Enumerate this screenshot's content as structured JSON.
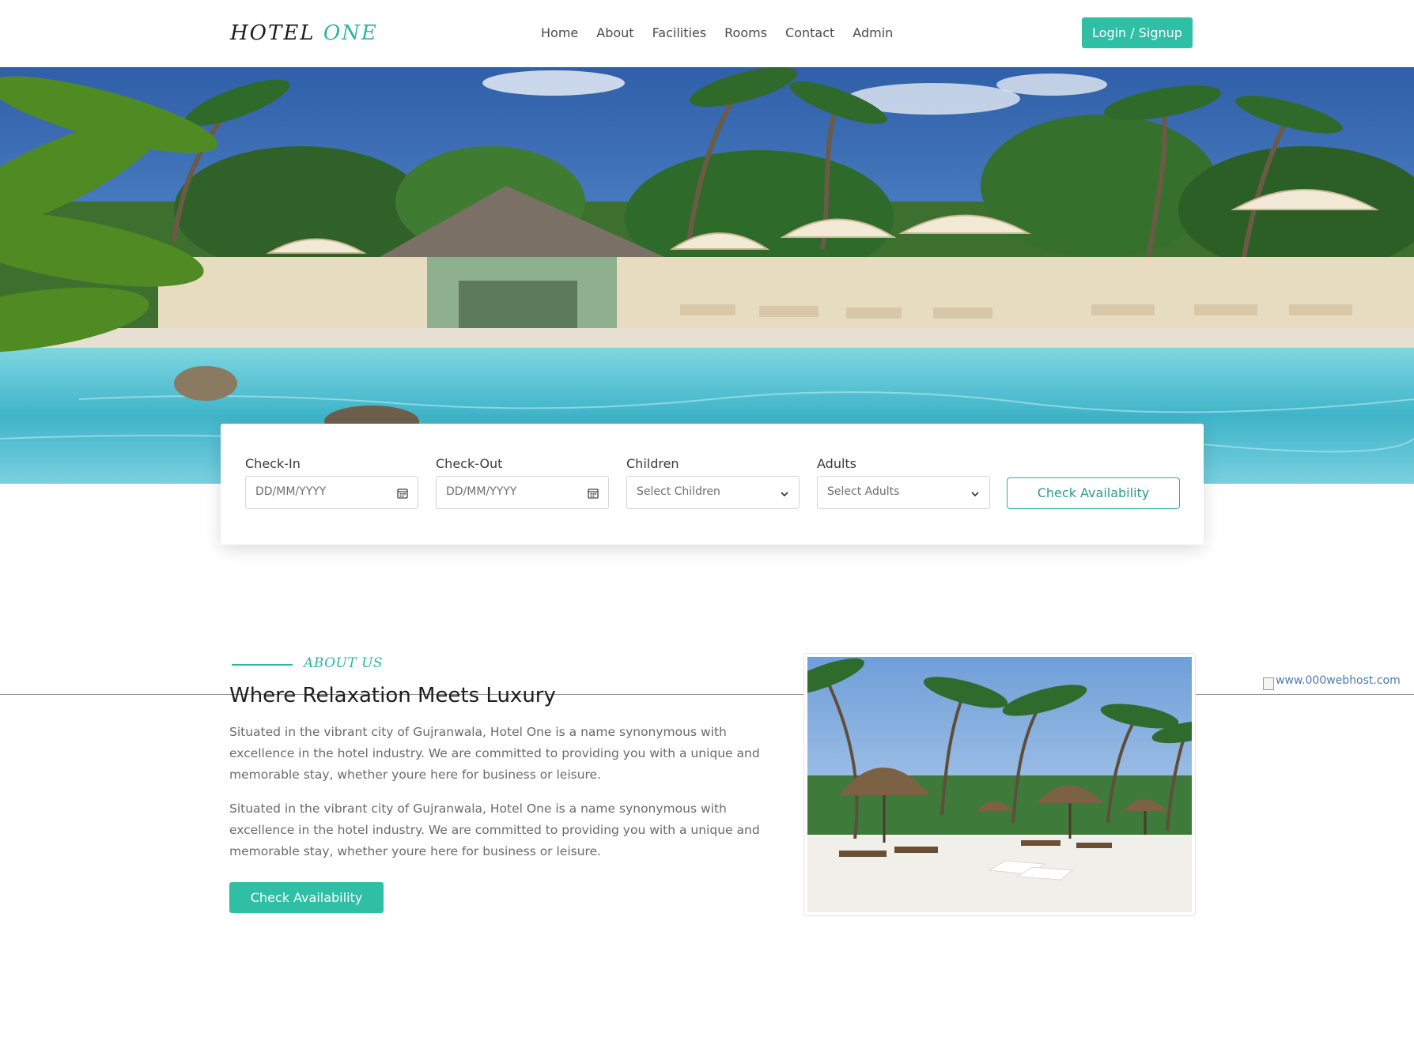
{
  "header": {
    "logo_word1": "HOTEL",
    "logo_word2": "ONE",
    "nav": [
      "Home",
      "About",
      "Facilities",
      "Rooms",
      "Contact",
      "Admin"
    ],
    "login_label": "Login / Signup"
  },
  "booking": {
    "checkin_label": "Check-In",
    "checkin_placeholder": "DD/MM/YYYY",
    "checkout_label": "Check-Out",
    "checkout_placeholder": "DD/MM/YYYY",
    "children_label": "Children",
    "children_value": "Select Children",
    "adults_label": "Adults",
    "adults_value": "Select Adults",
    "check_button": "Check Availability"
  },
  "about": {
    "eyebrow": "ABOUT US",
    "title": "Where Relaxation Meets Luxury",
    "para1": "Situated in the vibrant city of Gujranwala, Hotel One is a name synonymous with excellence in the hotel industry. We are committed to providing you with a unique and memorable stay, whether youre here for business or leisure.",
    "para2": "Situated in the vibrant city of Gujranwala, Hotel One is a name synonymous with excellence in the hotel industry. We are committed to providing you with a unique and memorable stay, whether youre here for business or leisure.",
    "button": "Check Availability"
  },
  "broken_image_alt": "www.000webhost.com",
  "colors": {
    "accent": "#2ebfa5",
    "text_dark": "#1e1e1e",
    "text_body": "#6a6a6a"
  }
}
